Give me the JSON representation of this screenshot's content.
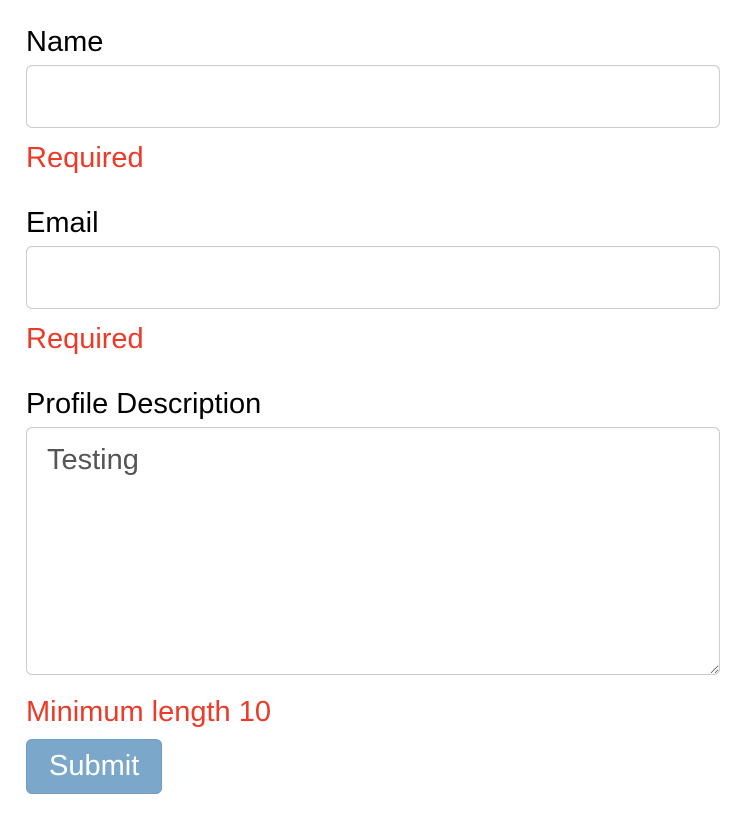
{
  "form": {
    "name": {
      "label": "Name",
      "value": "",
      "error": "Required"
    },
    "email": {
      "label": "Email",
      "value": "",
      "error": "Required"
    },
    "profile": {
      "label": "Profile Description",
      "value": "Testing",
      "error": "Minimum length 10"
    },
    "submit_label": "Submit"
  }
}
